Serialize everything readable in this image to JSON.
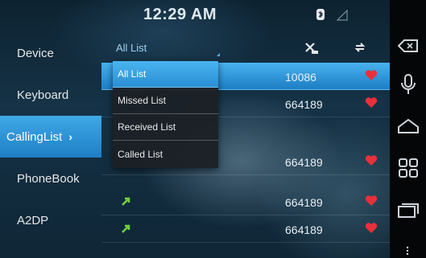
{
  "status_bar": {
    "time": "12:29 AM",
    "icons": [
      "bluetooth-icon",
      "signal-icon"
    ]
  },
  "sidebar": {
    "items": [
      {
        "label": "Device",
        "active": false
      },
      {
        "label": "Keyboard",
        "active": false
      },
      {
        "label": "CallingList",
        "active": true,
        "chevron": "›"
      },
      {
        "label": "PhoneBook",
        "active": false
      },
      {
        "label": "A2DP",
        "active": false
      }
    ]
  },
  "list_header": {
    "filter_label": "All List",
    "clear_icon": "clear-all-icon",
    "sync_icon": "sync-icon"
  },
  "dropdown": {
    "options": [
      "All List",
      "Missed List",
      "Received List",
      "Called List"
    ],
    "selected": "All List"
  },
  "call_list": [
    {
      "number": "10086",
      "highlighted": true,
      "type_icon": "",
      "favorite": true
    },
    {
      "number": "664189",
      "highlighted": false,
      "type_icon": "",
      "favorite": true
    },
    {
      "number": "664189",
      "highlighted": false,
      "type_icon": "",
      "favorite": true
    },
    {
      "number": "664189",
      "highlighted": false,
      "type_icon": "called-arrow-icon",
      "favorite": true
    },
    {
      "number": "664189",
      "highlighted": false,
      "type_icon": "called-arrow-icon",
      "favorite": true
    }
  ],
  "navbar": {
    "buttons": [
      "back-icon",
      "microphone-icon",
      "home-icon",
      "apps-icon",
      "recent-apps-icon",
      "menu-dots-icon"
    ]
  },
  "colors": {
    "accent": "#2a8ed3",
    "heart": "#e8303a",
    "called_arrow": "#6fcf3f",
    "header_text": "#9fd0f2"
  }
}
